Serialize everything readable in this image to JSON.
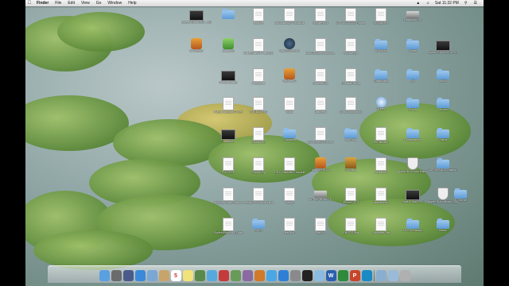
{
  "menubar": {
    "apple": "",
    "items": [
      "Finder",
      "File",
      "Edit",
      "View",
      "Go",
      "Window",
      "Help"
    ],
    "clock": "Sat 11:32 PM"
  },
  "desktop_icons": [
    {
      "label": "Screen Shot 2012-...6.00 PM",
      "kind": "dark",
      "col": 0,
      "row": 0
    },
    {
      "label": "",
      "kind": "folder",
      "col": 1,
      "row": 0
    },
    {
      "label": "readme",
      "kind": "doc",
      "col": 2,
      "row": 0
    },
    {
      "label": "instructions2.4 instructions",
      "kind": "doc",
      "col": 3,
      "row": 0
    },
    {
      "label": "recovery 24",
      "kind": "doc",
      "col": 4,
      "row": 0
    },
    {
      "label": "XAF-MAC-0000 Pages...",
      "kind": "doc",
      "col": 5,
      "row": 0
    },
    {
      "label": "MoSarKer x",
      "kind": "doc",
      "col": 6,
      "row": 0
    },
    {
      "label": "Macintosh HD",
      "kind": "disk",
      "col": 7,
      "row": 0
    },
    {
      "label": "cs Crypton",
      "kind": "app",
      "col": 0,
      "row": 1
    },
    {
      "label": "atlas.png",
      "kind": "green",
      "col": 1,
      "row": 1
    },
    {
      "label": "limitedSkinbrt 4 sets(Mac)",
      "kind": "doc",
      "col": 2,
      "row": 1
    },
    {
      "label": "MacOSXServer",
      "kind": "orbit",
      "col": 3,
      "row": 1
    },
    {
      "label": "MacOSXcommand for...",
      "kind": "doc",
      "col": 4,
      "row": 1
    },
    {
      "label": "Archive zip",
      "kind": "doc",
      "col": 5,
      "row": 1
    },
    {
      "label": "nfs-log.txt",
      "kind": "folder",
      "col": 6,
      "row": 1
    },
    {
      "label": "Index",
      "kind": "folder",
      "col": 7,
      "row": 1
    },
    {
      "label": "Screen Shot 2012-...9.57 PM",
      "kind": "dark",
      "col": 8,
      "row": 1
    },
    {
      "label": "iPhoto Library",
      "kind": "dark",
      "col": 1,
      "row": 2
    },
    {
      "label": "Atheos.rar",
      "kind": "doc",
      "col": 2,
      "row": 2
    },
    {
      "label": "MacFire.Ar",
      "kind": "app",
      "col": 3,
      "row": 2
    },
    {
      "label": "CameraRoll",
      "kind": "doc",
      "col": 4,
      "row": 2
    },
    {
      "label": "Uninstall guide",
      "kind": "doc",
      "col": 5,
      "row": 2
    },
    {
      "label": "Downloads",
      "kind": "folder",
      "col": 6,
      "row": 2
    },
    {
      "label": "Lbr",
      "kind": "folder",
      "col": 7,
      "row": 2
    },
    {
      "label": "Music",
      "kind": "folder",
      "col": 8,
      "row": 2
    },
    {
      "label": "Playlist support iTunes",
      "kind": "doc",
      "col": 1,
      "row": 3
    },
    {
      "label": "SMKBL4.KY3",
      "kind": "doc",
      "col": 2,
      "row": 3
    },
    {
      "label": "install",
      "kind": "doc",
      "col": 3,
      "row": 3
    },
    {
      "label": "Jailbreak",
      "kind": "doc",
      "col": 4,
      "row": 3
    },
    {
      "label": "Crash Support.txt",
      "kind": "doc",
      "col": 5,
      "row": 3
    },
    {
      "label": "iTunes",
      "kind": "itunes",
      "col": 6,
      "row": 3
    },
    {
      "label": "Scrolls",
      "kind": "folder",
      "col": 7,
      "row": 3
    },
    {
      "label": "Movies",
      "kind": "folder",
      "col": 8,
      "row": 3
    },
    {
      "label": "ioncube",
      "kind": "dark",
      "col": 1,
      "row": 4
    },
    {
      "label": "CDMM/RC",
      "kind": "doc",
      "col": 2,
      "row": 4
    },
    {
      "label": "Camtasia",
      "kind": "folder",
      "col": 3,
      "row": 4
    },
    {
      "label": "DIVASOLUTION zip",
      "kind": "doc",
      "col": 4,
      "row": 4
    },
    {
      "label": "MacPorts",
      "kind": "folder",
      "col": 5,
      "row": 4
    },
    {
      "label": "EnPlan.xml",
      "kind": "doc",
      "col": 6,
      "row": 4
    },
    {
      "label": "FolderMakers",
      "kind": "folder",
      "col": 7,
      "row": 4
    },
    {
      "label": "Videos",
      "kind": "folder",
      "col": 8,
      "row": 4
    },
    {
      "label": "FLAT.EXE",
      "kind": "doc",
      "col": 1,
      "row": 5
    },
    {
      "label": "SmbUp.zip",
      "kind": "doc",
      "col": 2,
      "row": 5
    },
    {
      "label": "OSX Yosemite Chameleon",
      "kind": "doc",
      "col": 3,
      "row": 5
    },
    {
      "label": "Mac OS ROM",
      "kind": "app",
      "col": 4,
      "row": 5
    },
    {
      "label": "DOSBox",
      "kind": "dos",
      "col": 5,
      "row": 5
    },
    {
      "label": "install.xml",
      "kind": "doc",
      "col": 6,
      "row": 5
    },
    {
      "label": "AppleHDACodec Backup",
      "kind": "shield",
      "col": 7,
      "row": 5
    },
    {
      "label": "APPAREADS Backup",
      "kind": "folder",
      "col": 8,
      "row": 5
    },
    {
      "label": "Windows Vista Starter 32 bit.iso",
      "kind": "doc",
      "col": 1,
      "row": 6
    },
    {
      "label": "VerbalAPPAndroid plugin",
      "kind": "doc",
      "col": 2,
      "row": 6
    },
    {
      "label": "Verbal",
      "kind": "doc",
      "col": 3,
      "row": 6
    },
    {
      "label": "APPLE REMOTE",
      "kind": "disk",
      "col": 4,
      "row": 6
    },
    {
      "label": "iPhone .JCS",
      "kind": "doc",
      "col": 5,
      "row": 6
    },
    {
      "label": "bkdpad.php",
      "kind": "doc",
      "col": 6,
      "row": 6
    },
    {
      "label": "Start to MacOSX",
      "kind": "dark",
      "col": 7,
      "row": 6
    },
    {
      "label": "AppleHDAonBoard Backup",
      "kind": "shield",
      "col": 8,
      "row": 6
    },
    {
      "label": "MC Server",
      "kind": "folder",
      "col": 9,
      "row": 6
    },
    {
      "label": "SystemVersion 10.plist",
      "kind": "doc",
      "col": 1,
      "row": 7
    },
    {
      "label": "SNES",
      "kind": "folder",
      "col": 2,
      "row": 7
    },
    {
      "label": "test.img",
      "kind": "doc",
      "col": 3,
      "row": 7
    },
    {
      "label": "Macvol",
      "kind": "doc",
      "col": 4,
      "row": 7
    },
    {
      "label": "EstVOS.img",
      "kind": "doc",
      "col": 5,
      "row": 7
    },
    {
      "label": "Computer List",
      "kind": "doc",
      "col": 6,
      "row": 7
    },
    {
      "label": "MC SD Backup",
      "kind": "folder",
      "col": 7,
      "row": 7
    },
    {
      "label": "bitcoin",
      "kind": "folder",
      "col": 8,
      "row": 7
    }
  ],
  "dock": [
    {
      "name": "finder-icon",
      "color": "#5aa0e0",
      "glyph": ""
    },
    {
      "name": "launchpad-icon",
      "color": "#6b6b6b",
      "glyph": ""
    },
    {
      "name": "mission-control-icon",
      "color": "#4a5a8a",
      "glyph": ""
    },
    {
      "name": "safari-icon",
      "color": "#3b8ad9",
      "glyph": ""
    },
    {
      "name": "mail-icon",
      "color": "#7aa7d6",
      "glyph": ""
    },
    {
      "name": "contacts-icon",
      "color": "#c9a46a",
      "glyph": ""
    },
    {
      "name": "calendar-icon",
      "color": "#ffffff",
      "glyph": "5"
    },
    {
      "name": "notes-icon",
      "color": "#f2e27a",
      "glyph": ""
    },
    {
      "name": "facetime-icon",
      "color": "#5a8a4a",
      "glyph": ""
    },
    {
      "name": "messages-icon",
      "color": "#58a8e0",
      "glyph": ""
    },
    {
      "name": "photo-booth-icon",
      "color": "#c53b3b",
      "glyph": ""
    },
    {
      "name": "iphoto-icon",
      "color": "#6a9a5a",
      "glyph": ""
    },
    {
      "name": "imovie-icon",
      "color": "#8a6aa0",
      "glyph": ""
    },
    {
      "name": "garageband-icon",
      "color": "#d07a2a",
      "glyph": ""
    },
    {
      "name": "itunes-icon",
      "color": "#4ba6e6",
      "glyph": ""
    },
    {
      "name": "app-store-icon",
      "color": "#2f7fd6",
      "glyph": ""
    },
    {
      "name": "system-preferences-icon",
      "color": "#8a8a8a",
      "glyph": ""
    },
    {
      "name": "terminal-icon",
      "color": "#222222",
      "glyph": ""
    },
    {
      "name": "preview-icon",
      "color": "#8bbbe0",
      "glyph": ""
    },
    {
      "name": "word-icon",
      "color": "#2b5fad",
      "glyph": "W"
    },
    {
      "name": "excel-icon",
      "color": "#2f8a3a",
      "glyph": ""
    },
    {
      "name": "powerpoint-icon",
      "color": "#c8452a",
      "glyph": "P"
    },
    {
      "name": "app-icon",
      "color": "#1a8ac4",
      "glyph": ""
    },
    {
      "name": "sep",
      "color": "",
      "glyph": ""
    },
    {
      "name": "downloads-stack-icon",
      "color": "#8aaed0",
      "glyph": ""
    },
    {
      "name": "documents-stack-icon",
      "color": "#9abad8",
      "glyph": ""
    },
    {
      "name": "trash-icon",
      "color": "#b0b0b0",
      "glyph": ""
    }
  ]
}
